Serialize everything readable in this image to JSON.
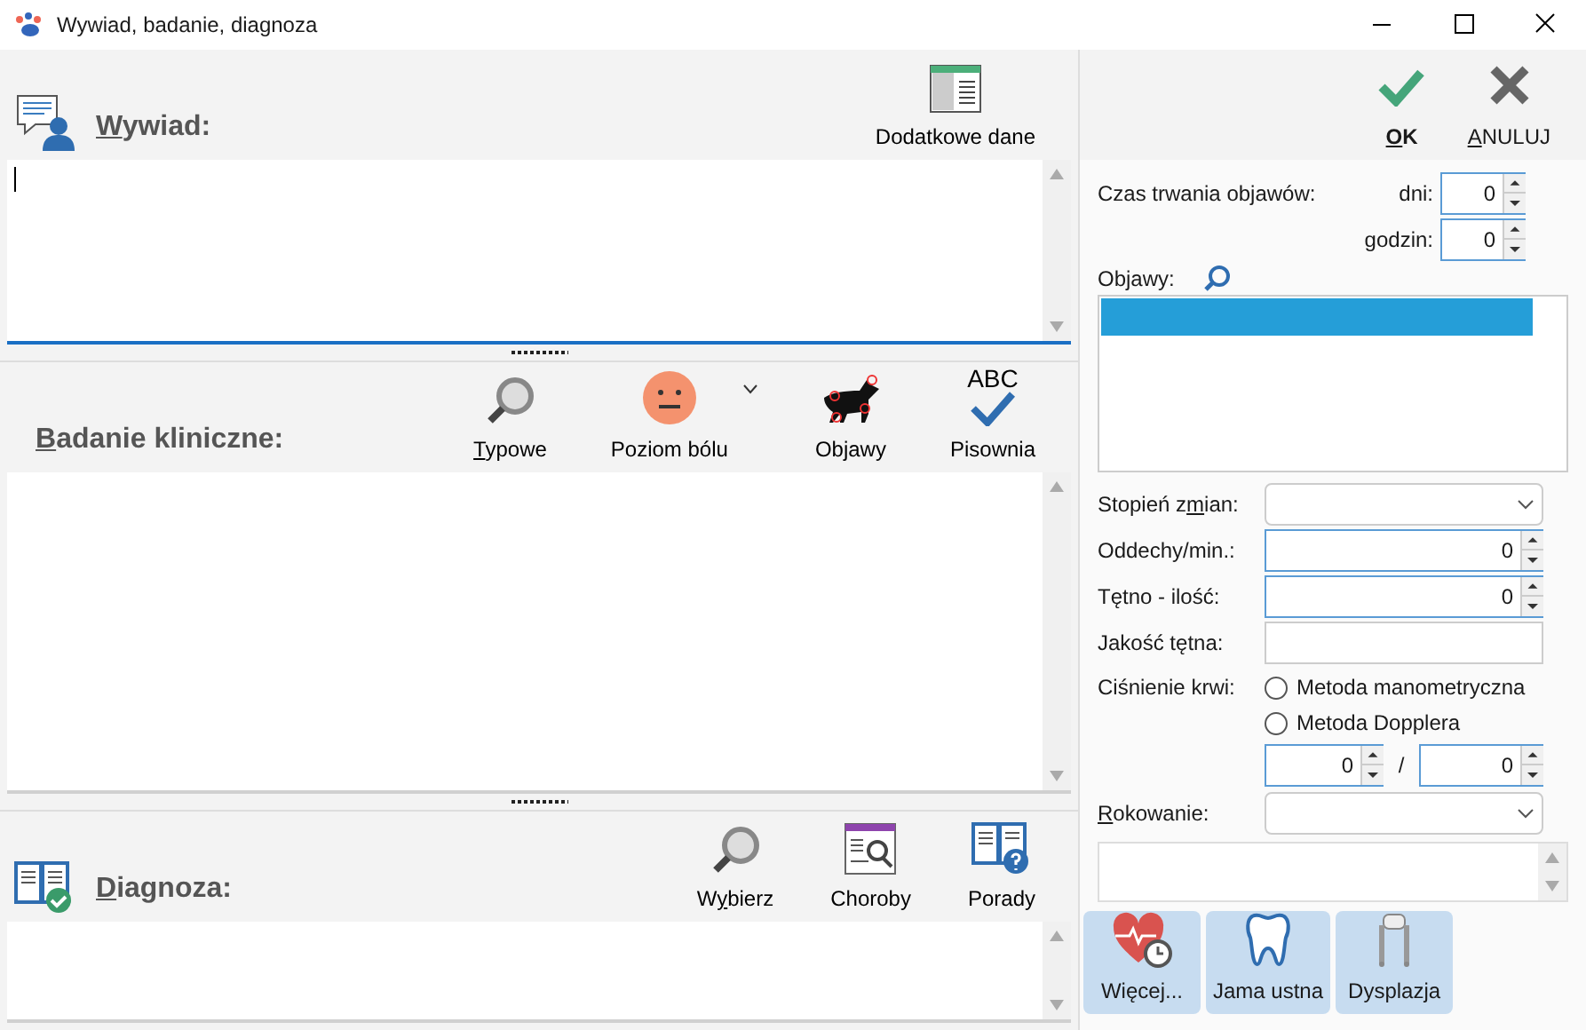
{
  "window": {
    "title": "Wywiad, badanie, diagnoza"
  },
  "sections": [
    {
      "kind": "wywiad",
      "title": {
        "key": "W",
        "after": "ywiad:"
      },
      "focused": true,
      "tools": [
        {
          "kind": "table",
          "label": {
            "before": "Dodatkowe dane"
          }
        }
      ]
    },
    {
      "kind": "badanie",
      "title": {
        "key": "B",
        "after": "adanie kliniczne:"
      },
      "focused": false,
      "tools": [
        {
          "kind": "magnifier",
          "label": {
            "key": "T",
            "after": "ypowe"
          }
        },
        {
          "kind": "face",
          "label": {
            "before": "Poziom bólu"
          },
          "dropdown": true
        },
        {
          "kind": "dog",
          "label": {
            "before": "Objawy"
          }
        },
        {
          "kind": "spell",
          "label": {
            "before": "Pisownia"
          },
          "icon_text": "ABC"
        }
      ]
    },
    {
      "kind": "diagnoza",
      "title": {
        "key": "D",
        "after": "iagnoza:"
      },
      "focused": false,
      "tools": [
        {
          "kind": "magnifier",
          "label": {
            "before": "W",
            "key": "y",
            "after": "bierz"
          }
        },
        {
          "kind": "diseases",
          "label": {
            "before": "Choroby"
          }
        },
        {
          "kind": "book",
          "label": {
            "before": "Porady"
          }
        }
      ]
    }
  ],
  "actions": [
    {
      "kind": "ok",
      "label": {
        "key": "O",
        "after": "K"
      }
    },
    {
      "kind": "cancel",
      "label": {
        "key": "A",
        "after": "NULUJ"
      }
    }
  ],
  "duration": {
    "label": "Czas trwania objawów:",
    "days": {
      "label": "dni:",
      "value": "0"
    },
    "hours": {
      "label": "godzin:",
      "value": "0"
    }
  },
  "symptoms": {
    "label": "Objawy:",
    "highlighted_row": true
  },
  "form": [
    {
      "kind": "select",
      "label": {
        "before": "Stopień z",
        "key": "m",
        "after": "ian:"
      }
    },
    {
      "kind": "spin",
      "label": {
        "before": "Oddechy/min.:"
      },
      "value": "0"
    },
    {
      "kind": "spin",
      "label": {
        "before": "Tętno - ilość:"
      },
      "value": "0"
    },
    {
      "kind": "text",
      "label": {
        "before": "Jakość tętna:"
      }
    }
  ],
  "pressure": {
    "label": "Ciśnienie krwi:",
    "methods": [
      {
        "label": "Metoda manometryczna",
        "selected": false
      },
      {
        "label": "Metoda Dopplera",
        "selected": false
      }
    ],
    "systolic": "0",
    "separator": "/",
    "diastolic": "0"
  },
  "prognosis": {
    "label": {
      "key": "R",
      "after": "okowanie:"
    }
  },
  "bottom_buttons": [
    {
      "kind": "heart",
      "label": "Więcej..."
    },
    {
      "kind": "tooth",
      "label": "Jama ustna"
    },
    {
      "kind": "hips",
      "label": "Dysplazja"
    }
  ]
}
